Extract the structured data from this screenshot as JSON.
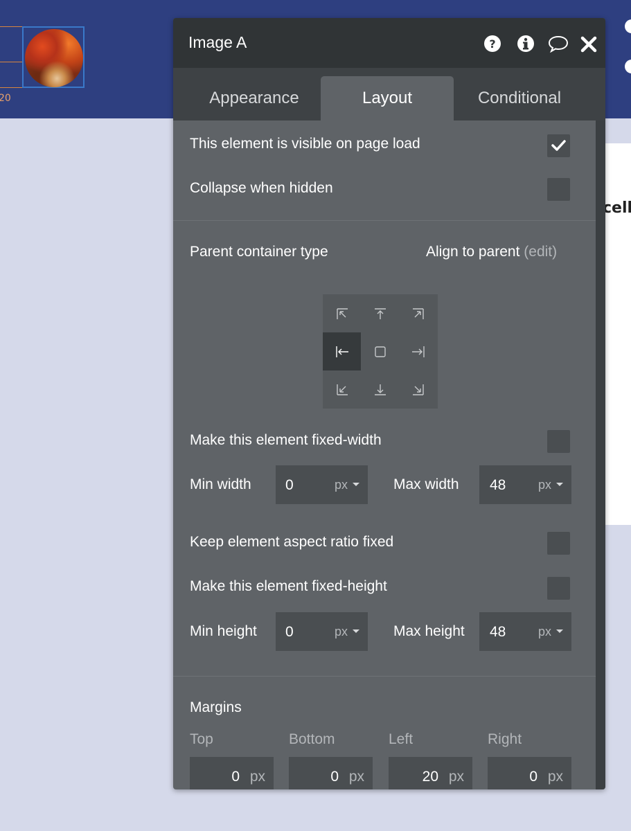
{
  "canvas": {
    "margin_label": "20",
    "partial_text": "cell"
  },
  "panel": {
    "title": "Image A",
    "header_icons": [
      "help-icon",
      "info-icon",
      "comment-icon",
      "close-icon"
    ],
    "tabs": [
      {
        "label": "Appearance",
        "active": false
      },
      {
        "label": "Layout",
        "active": true
      },
      {
        "label": "Conditional",
        "active": false
      }
    ]
  },
  "visibility": {
    "visible_label": "This element is visible on page load",
    "visible_checked": true,
    "collapse_label": "Collapse when hidden",
    "collapse_checked": false
  },
  "parent": {
    "container_label": "Parent container type",
    "align_label": "Align to parent",
    "edit_label": "(edit)",
    "alignment_selected": "center-left",
    "alignment_icons": [
      "align-top-left-icon",
      "align-top-center-icon",
      "align-top-right-icon",
      "align-center-left-icon",
      "align-center-icon",
      "align-center-right-icon",
      "align-bottom-left-icon",
      "align-bottom-center-icon",
      "align-bottom-right-icon"
    ]
  },
  "width": {
    "fixed_label": "Make this element fixed-width",
    "fixed_checked": false,
    "min_label": "Min width",
    "min_value": "0",
    "min_unit": "px",
    "max_label": "Max width",
    "max_value": "48",
    "max_unit": "px"
  },
  "aspect": {
    "label": "Keep element aspect ratio fixed",
    "checked": false
  },
  "height": {
    "fixed_label": "Make this element fixed-height",
    "fixed_checked": false,
    "min_label": "Min height",
    "min_value": "0",
    "min_unit": "px",
    "max_label": "Max height",
    "max_value": "48",
    "max_unit": "px"
  },
  "margins": {
    "section_label": "Margins",
    "unit": "px",
    "fields": [
      {
        "label": "Top",
        "value": "0"
      },
      {
        "label": "Bottom",
        "value": "0"
      },
      {
        "label": "Left",
        "value": "20"
      },
      {
        "label": "Right",
        "value": "0"
      }
    ]
  },
  "colors": {
    "topbar": "#2e3f80",
    "panel_bg": "#5f6367",
    "panel_header": "#303436",
    "selection_orange": "#d9863f",
    "selection_blue": "#3a79c9"
  }
}
